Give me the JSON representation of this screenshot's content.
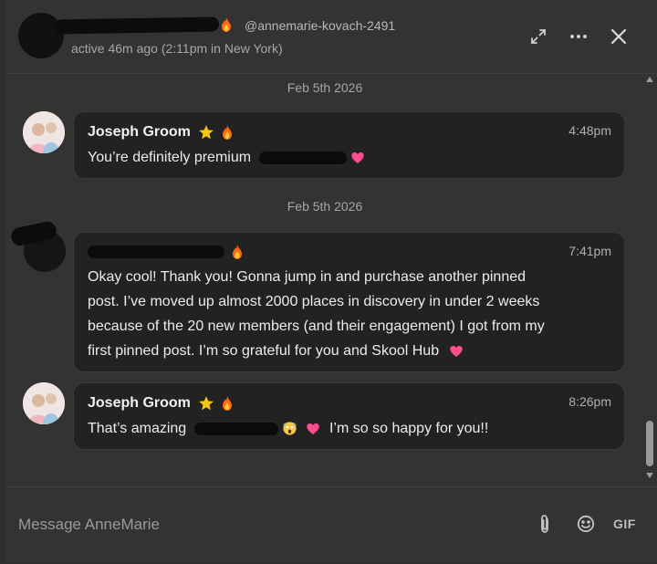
{
  "header": {
    "handle": "@annemarie-kovach-2491",
    "status": "active 46m ago (2:11pm in New York)"
  },
  "messages": [
    {
      "date": "Feb 5th 2026",
      "sender": "Joseph Groom",
      "time": "4:48pm",
      "text": "You’re definitely premium"
    },
    {
      "date": "Feb 5th 2026",
      "sender": "",
      "time": "7:41pm",
      "lines": [
        "Okay cool! Thank you! Gonna jump in and purchase another pinned",
        "post. I’ve moved up almost 2000 places in discovery in under 2 weeks",
        "because of the 20 new members (and their engagement) I got from my",
        "first pinned post. I’m so grateful for you and Skool Hub"
      ]
    },
    {
      "sender": "Joseph Groom",
      "time": "8:26pm",
      "text_before": "That’s amazing",
      "text_after": "I’m so so happy for you!!"
    }
  ],
  "composer": {
    "placeholder": "Message AnneMarie",
    "gif_label": "GIF"
  },
  "icons": {
    "close": "close-icon",
    "expand": "expand-icon",
    "more": "more-icon",
    "star": "star-icon",
    "flame": "flame-icon",
    "attach": "paperclip-icon",
    "emoji": "emoji-icon"
  },
  "colors": {
    "background": "#333333",
    "bubble": "#222222",
    "star": "#f5c518",
    "flame": "#ff7a1a",
    "heart": "#ff4d8d"
  }
}
